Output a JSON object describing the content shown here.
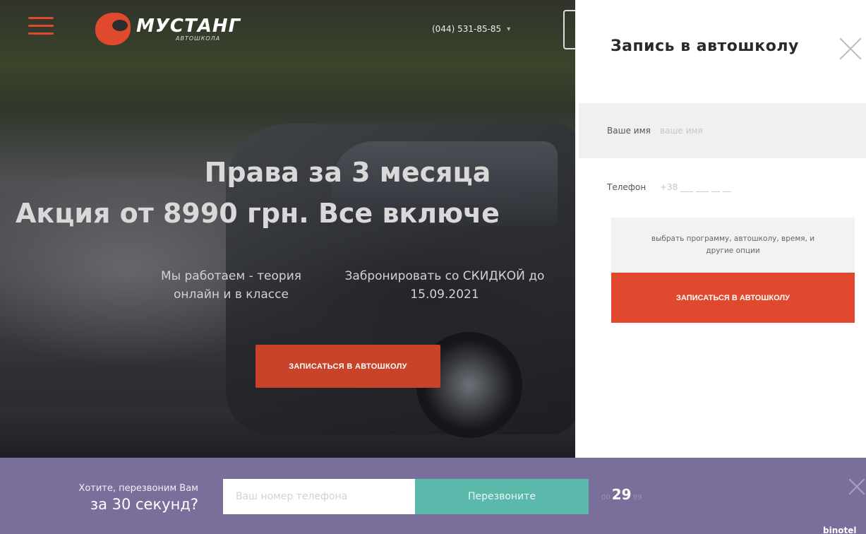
{
  "header": {
    "logo_name": "МУСТАНГ",
    "logo_sub": "АВТОШКОЛА",
    "phone": "(044) 531-85-85",
    "accent_color": "#e0492d"
  },
  "hero": {
    "headline_1": "Права за 3 месяца",
    "headline_2": "Акция от 8990 грн. Все включе",
    "sub_left": "Мы работаем - теория онлайн и в классе",
    "sub_right": "Забронировать со СКИДКОЙ до 15.09.2021",
    "cta_label": "ЗАПИСАТЬСЯ В АВТОШКОЛУ"
  },
  "panel": {
    "title": "Запись в автошколу",
    "name_label": "Ваше имя",
    "name_placeholder": "ваше имя",
    "phone_label": "Телефон",
    "phone_placeholder": "+38 ___ ___ __ __",
    "options_text": "выбрать программу, автошколу, время, и другие опции",
    "cta_label": "ЗАПИСАТЬСЯ В АВТОШКОЛУ"
  },
  "callback": {
    "question_small": "Хотите, перезвоним Вам",
    "question_big": "за 30 секунд?",
    "phone_placeholder": "Ваш номер телефона",
    "button_label": "Перезвоните",
    "timer_left": "00",
    "timer_main": "29",
    "timer_right": "99",
    "brand": "binotel",
    "bar_color": "#7a6f9a",
    "button_color": "#5ab9ab"
  }
}
